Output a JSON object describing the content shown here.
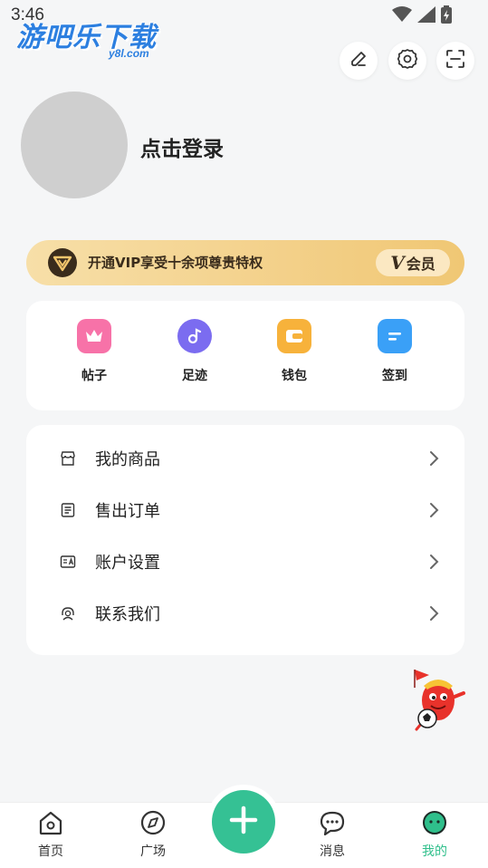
{
  "status_bar": {
    "time": "3:46",
    "icons": [
      "wifi-icon",
      "signal-icon",
      "battery-icon"
    ]
  },
  "watermark": {
    "text": "游吧乐下载",
    "sub": "y8l.com"
  },
  "top_actions": [
    "edit-icon",
    "settings-icon",
    "scan-icon"
  ],
  "profile": {
    "login_label": "点击登录"
  },
  "vip": {
    "text": "开通VIP享受十余项尊贵特权",
    "badge_v": "V",
    "badge_label": "会员"
  },
  "quick_items": [
    {
      "label": "帖子",
      "icon": "crown-icon",
      "color": "#f772a8"
    },
    {
      "label": "足迹",
      "icon": "music-note-icon",
      "color": "#7b6cf0"
    },
    {
      "label": "钱包",
      "icon": "wallet-icon",
      "color": "#f7b23b"
    },
    {
      "label": "签到",
      "icon": "checkin-icon",
      "color": "#3aa0f7"
    }
  ],
  "menu": [
    {
      "label": "我的商品",
      "icon": "store-icon"
    },
    {
      "label": "售出订单",
      "icon": "order-list-icon"
    },
    {
      "label": "账户设置",
      "icon": "account-card-icon"
    },
    {
      "label": "联系我们",
      "icon": "headset-icon"
    }
  ],
  "bottom_nav": [
    {
      "label": "首页",
      "icon": "home-icon",
      "active": false
    },
    {
      "label": "广场",
      "icon": "compass-icon",
      "active": false
    },
    {
      "label": "消息",
      "icon": "message-icon",
      "active": false
    },
    {
      "label": "我的",
      "icon": "face-icon",
      "active": true
    }
  ],
  "colors": {
    "accent": "#35c194",
    "active_nav": "#2fbf8b",
    "vip_gold": "#f3d089",
    "background": "#f5f6f7"
  }
}
